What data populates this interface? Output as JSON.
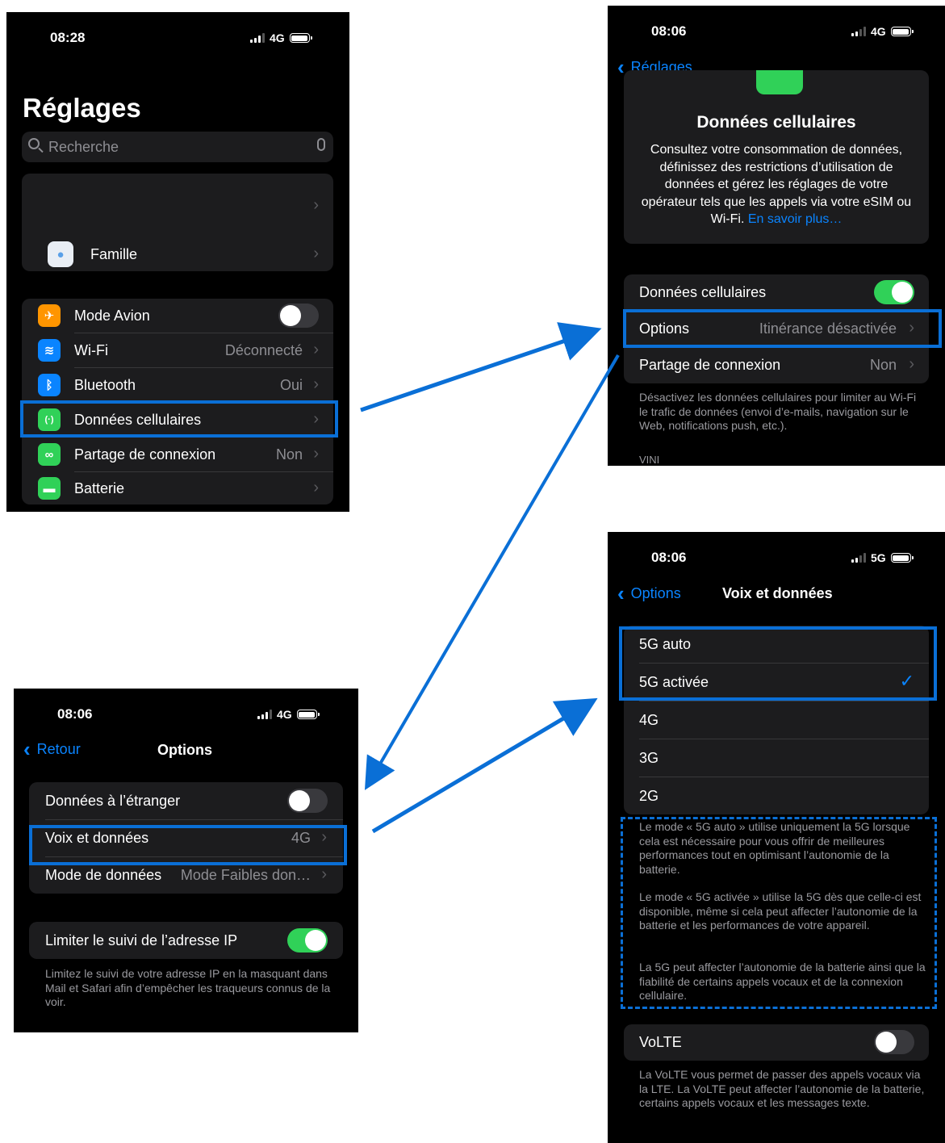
{
  "screen1": {
    "time": "08:28",
    "network": "4G",
    "title": "Réglages",
    "search_placeholder": "Recherche",
    "famille": "Famille",
    "rows": [
      {
        "label": "Mode Avion",
        "value": ""
      },
      {
        "label": "Wi-Fi",
        "value": "Déconnecté"
      },
      {
        "label": "Bluetooth",
        "value": "Oui"
      },
      {
        "label": "Données cellulaires",
        "value": ""
      },
      {
        "label": "Partage de connexion",
        "value": "Non"
      },
      {
        "label": "Batterie",
        "value": ""
      }
    ],
    "airplane_mode_on": false
  },
  "screen2": {
    "time": "08:06",
    "network": "4G",
    "back": "Réglages",
    "title": "Données cellulaires",
    "description": "Consultez votre consommation de données, définissez des restrictions d’utilisation de données et gérez les réglages de votre opérateur tels que les appels via votre eSIM ou Wi-Fi.",
    "learn_more": "En savoir plus…",
    "rows": [
      {
        "label": "Données cellulaires",
        "value": ""
      },
      {
        "label": "Options",
        "value": "Itinérance désactivée"
      },
      {
        "label": "Partage de connexion",
        "value": "Non"
      }
    ],
    "cellular_on": true,
    "footer": "Désactivez les données cellulaires pour limiter au Wi-Fi le trafic de données (envoi d’e-mails, navigation sur le Web, notifications push, etc.).",
    "carrier": "VINI"
  },
  "screen3": {
    "time": "08:06",
    "network": "4G",
    "back": "Retour",
    "title": "Options",
    "rows": [
      {
        "label": "Données à l’étranger",
        "value": ""
      },
      {
        "label": "Voix et données",
        "value": "4G"
      },
      {
        "label": "Mode de données",
        "value": "Mode Faibles don…"
      }
    ],
    "roaming_on": false,
    "ip_label": "Limiter le suivi de l’adresse IP",
    "ip_on": true,
    "ip_footer": "Limitez le suivi de votre adresse IP en la masquant dans Mail et Safari afin d’empêcher les traqueurs connus de la voir."
  },
  "screen4": {
    "time": "08:06",
    "network": "5G",
    "back": "Options",
    "title": "Voix et données",
    "options": [
      "5G auto",
      "5G activée",
      "4G",
      "3G",
      "2G"
    ],
    "selected": "5G activée",
    "info1": "Le mode « 5G auto » utilise uniquement la 5G lorsque cela est nécessaire pour vous offrir de meilleures performances tout en optimisant l’autonomie de la batterie.",
    "info2": "Le mode « 5G activée » utilise la 5G dès que celle-ci est disponible, même si cela peut affecter l’autonomie de la batterie et les performances de votre appareil.",
    "info3": "La 5G peut affecter l’autonomie de la batterie ainsi que la fiabilité de certains appels vocaux et de la connexion cellulaire.",
    "volte_label": "VoLTE",
    "volte_on": false,
    "volte_footer": "La VoLTE vous permet de passer des appels vocaux via la LTE. La VoLTE peut affecter l’autonomie de la batterie, certains appels vocaux et les messages texte."
  },
  "colors": {
    "highlight": "#0a6fd6",
    "accent": "#0a84ff",
    "toggle_on": "#30d158",
    "screen_bg": "#000000",
    "cell_bg": "#1c1c1e"
  }
}
